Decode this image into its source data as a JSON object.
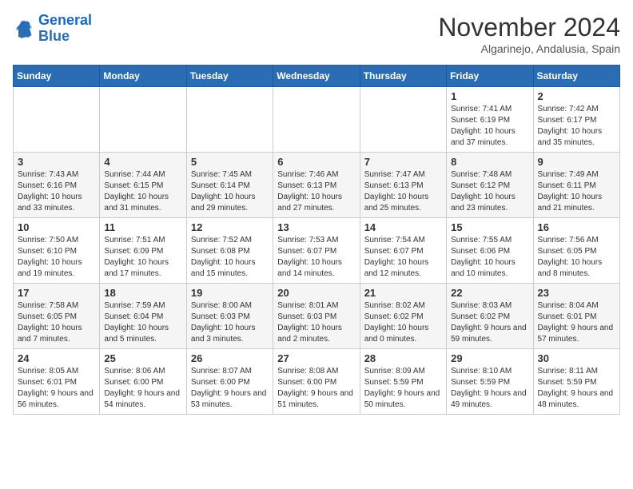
{
  "logo": {
    "line1": "General",
    "line2": "Blue"
  },
  "title": "November 2024",
  "location": "Algarinejo, Andalusia, Spain",
  "weekdays": [
    "Sunday",
    "Monday",
    "Tuesday",
    "Wednesday",
    "Thursday",
    "Friday",
    "Saturday"
  ],
  "weeks": [
    [
      {
        "day": "",
        "info": ""
      },
      {
        "day": "",
        "info": ""
      },
      {
        "day": "",
        "info": ""
      },
      {
        "day": "",
        "info": ""
      },
      {
        "day": "",
        "info": ""
      },
      {
        "day": "1",
        "info": "Sunrise: 7:41 AM\nSunset: 6:19 PM\nDaylight: 10 hours and 37 minutes."
      },
      {
        "day": "2",
        "info": "Sunrise: 7:42 AM\nSunset: 6:17 PM\nDaylight: 10 hours and 35 minutes."
      }
    ],
    [
      {
        "day": "3",
        "info": "Sunrise: 7:43 AM\nSunset: 6:16 PM\nDaylight: 10 hours and 33 minutes."
      },
      {
        "day": "4",
        "info": "Sunrise: 7:44 AM\nSunset: 6:15 PM\nDaylight: 10 hours and 31 minutes."
      },
      {
        "day": "5",
        "info": "Sunrise: 7:45 AM\nSunset: 6:14 PM\nDaylight: 10 hours and 29 minutes."
      },
      {
        "day": "6",
        "info": "Sunrise: 7:46 AM\nSunset: 6:13 PM\nDaylight: 10 hours and 27 minutes."
      },
      {
        "day": "7",
        "info": "Sunrise: 7:47 AM\nSunset: 6:13 PM\nDaylight: 10 hours and 25 minutes."
      },
      {
        "day": "8",
        "info": "Sunrise: 7:48 AM\nSunset: 6:12 PM\nDaylight: 10 hours and 23 minutes."
      },
      {
        "day": "9",
        "info": "Sunrise: 7:49 AM\nSunset: 6:11 PM\nDaylight: 10 hours and 21 minutes."
      }
    ],
    [
      {
        "day": "10",
        "info": "Sunrise: 7:50 AM\nSunset: 6:10 PM\nDaylight: 10 hours and 19 minutes."
      },
      {
        "day": "11",
        "info": "Sunrise: 7:51 AM\nSunset: 6:09 PM\nDaylight: 10 hours and 17 minutes."
      },
      {
        "day": "12",
        "info": "Sunrise: 7:52 AM\nSunset: 6:08 PM\nDaylight: 10 hours and 15 minutes."
      },
      {
        "day": "13",
        "info": "Sunrise: 7:53 AM\nSunset: 6:07 PM\nDaylight: 10 hours and 14 minutes."
      },
      {
        "day": "14",
        "info": "Sunrise: 7:54 AM\nSunset: 6:07 PM\nDaylight: 10 hours and 12 minutes."
      },
      {
        "day": "15",
        "info": "Sunrise: 7:55 AM\nSunset: 6:06 PM\nDaylight: 10 hours and 10 minutes."
      },
      {
        "day": "16",
        "info": "Sunrise: 7:56 AM\nSunset: 6:05 PM\nDaylight: 10 hours and 8 minutes."
      }
    ],
    [
      {
        "day": "17",
        "info": "Sunrise: 7:58 AM\nSunset: 6:05 PM\nDaylight: 10 hours and 7 minutes."
      },
      {
        "day": "18",
        "info": "Sunrise: 7:59 AM\nSunset: 6:04 PM\nDaylight: 10 hours and 5 minutes."
      },
      {
        "day": "19",
        "info": "Sunrise: 8:00 AM\nSunset: 6:03 PM\nDaylight: 10 hours and 3 minutes."
      },
      {
        "day": "20",
        "info": "Sunrise: 8:01 AM\nSunset: 6:03 PM\nDaylight: 10 hours and 2 minutes."
      },
      {
        "day": "21",
        "info": "Sunrise: 8:02 AM\nSunset: 6:02 PM\nDaylight: 10 hours and 0 minutes."
      },
      {
        "day": "22",
        "info": "Sunrise: 8:03 AM\nSunset: 6:02 PM\nDaylight: 9 hours and 59 minutes."
      },
      {
        "day": "23",
        "info": "Sunrise: 8:04 AM\nSunset: 6:01 PM\nDaylight: 9 hours and 57 minutes."
      }
    ],
    [
      {
        "day": "24",
        "info": "Sunrise: 8:05 AM\nSunset: 6:01 PM\nDaylight: 9 hours and 56 minutes."
      },
      {
        "day": "25",
        "info": "Sunrise: 8:06 AM\nSunset: 6:00 PM\nDaylight: 9 hours and 54 minutes."
      },
      {
        "day": "26",
        "info": "Sunrise: 8:07 AM\nSunset: 6:00 PM\nDaylight: 9 hours and 53 minutes."
      },
      {
        "day": "27",
        "info": "Sunrise: 8:08 AM\nSunset: 6:00 PM\nDaylight: 9 hours and 51 minutes."
      },
      {
        "day": "28",
        "info": "Sunrise: 8:09 AM\nSunset: 5:59 PM\nDaylight: 9 hours and 50 minutes."
      },
      {
        "day": "29",
        "info": "Sunrise: 8:10 AM\nSunset: 5:59 PM\nDaylight: 9 hours and 49 minutes."
      },
      {
        "day": "30",
        "info": "Sunrise: 8:11 AM\nSunset: 5:59 PM\nDaylight: 9 hours and 48 minutes."
      }
    ]
  ]
}
